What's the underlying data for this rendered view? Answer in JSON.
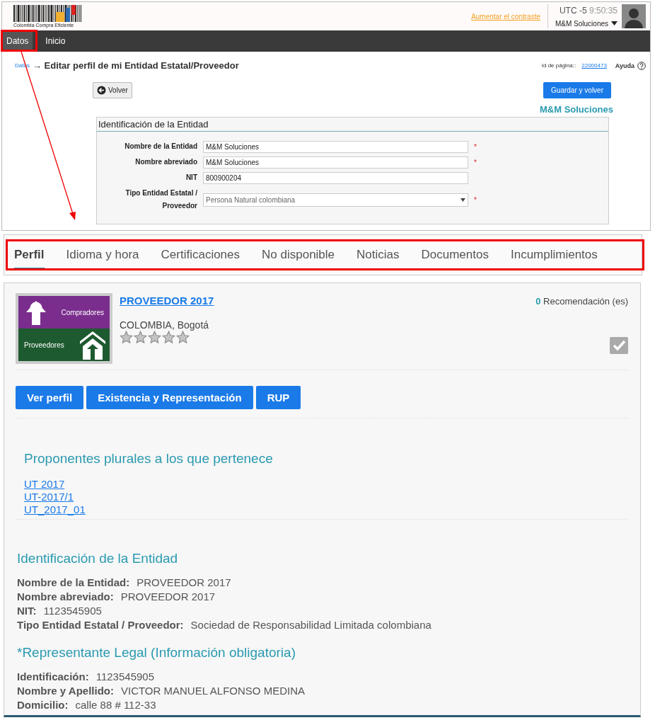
{
  "header": {
    "logo_caption": "Colombia Compra Eficiente",
    "contrast_link": "Aumentar el contraste",
    "timezone": "UTC -5",
    "time": "9:50:35",
    "user": "M&M Soluciones"
  },
  "menu": [
    {
      "label": "Datos",
      "selected": true
    },
    {
      "label": "Inicio",
      "selected": false
    }
  ],
  "breadcrumb": {
    "link": "Datos",
    "title": "→ Editar perfil de mi Entidad Estatal/Proveedor",
    "page_id_label": "Id de página::",
    "page_id": "22000473",
    "help": "Ayuda"
  },
  "back_button": "Volver",
  "save_button": "Guardar y volver",
  "entity_name": "M&M Soluciones",
  "form": {
    "title": "Identificación de la Entidad",
    "fields": [
      {
        "label": "Nombre de la Entidad",
        "value": "M&M Soluciones",
        "kind": "text",
        "required_mark": "*"
      },
      {
        "label": "Nombre abreviado",
        "value": "M&M Soluciones",
        "kind": "text",
        "required_mark": "*"
      },
      {
        "label": "NIT",
        "value": "800900204",
        "kind": "text"
      },
      {
        "label": "Tipo Entidad Estatal / Proveedor",
        "value": "Persona Natural colombiana",
        "kind": "select",
        "required_mark": "*"
      }
    ]
  },
  "tabs": [
    {
      "label": "Perfil",
      "selected": true
    },
    {
      "label": "Idioma y hora",
      "selected": false
    },
    {
      "label": "Certificaciones",
      "selected": false
    },
    {
      "label": "No disponible",
      "selected": false
    },
    {
      "label": "Noticias",
      "selected": false
    },
    {
      "label": "Documentos",
      "selected": false
    },
    {
      "label": "Incumplimientos",
      "selected": false
    }
  ],
  "profile": {
    "name": "PROVEEDOR 2017",
    "location": "COLOMBIA, Bogotá",
    "stars": 0,
    "recommendations_count": "0",
    "recommendations_label": "Recomendación (es)",
    "logo": {
      "top": "Compradores",
      "bottom": "Proveedores"
    },
    "buttons": [
      "Ver perfil",
      "Existencia y Representación",
      "RUP"
    ],
    "plural_title": "Proponentes plurales a los que pertenece",
    "plural_links": [
      "UT 2017",
      "UT-2017/1",
      "UT_2017_01"
    ],
    "sections": [
      {
        "title": "Identificación de la Entidad",
        "rows": [
          {
            "label": "Nombre de la Entidad:",
            "value": "PROVEEDOR 2017"
          },
          {
            "label": "Nombre abreviado:",
            "value": "PROVEEDOR 2017"
          },
          {
            "label": "NIT:",
            "value": "1123545905"
          },
          {
            "label": "Tipo Entidad Estatal / Proveedor:",
            "value": "Sociedad de Responsabilidad Limitada colombiana"
          }
        ]
      },
      {
        "title": "*Representante Legal (Información obligatoria)",
        "rows": [
          {
            "label": "Identificación:",
            "value": "1123545905"
          },
          {
            "label": "Nombre y Apellido:",
            "value": "VICTOR MANUEL ALFONSO MEDINA"
          },
          {
            "label": "Domicilio:",
            "value": "calle 88 # 112-33"
          }
        ]
      }
    ]
  }
}
